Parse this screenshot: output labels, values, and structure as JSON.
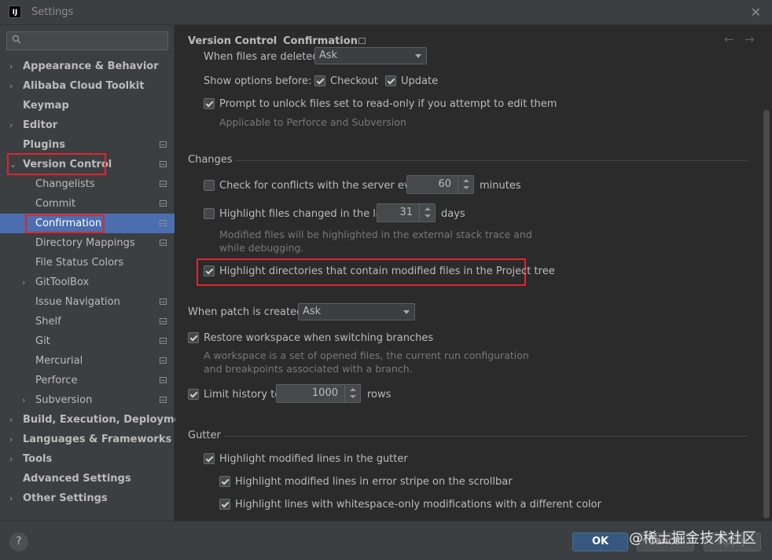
{
  "window": {
    "app_logo": "IJ",
    "title": "Settings",
    "close": "✕"
  },
  "sidebar": {
    "search_placeholder": "",
    "items": [
      {
        "label": "Appearance & Behavior",
        "arrow": "›",
        "bold": true
      },
      {
        "label": "Alibaba Cloud Toolkit",
        "arrow": "›",
        "bold": true
      },
      {
        "label": "Keymap",
        "arrow": "",
        "bold": true
      },
      {
        "label": "Editor",
        "arrow": "›",
        "bold": true
      },
      {
        "label": "Plugins",
        "arrow": "",
        "bold": true,
        "page_icon": true
      },
      {
        "label": "Version Control",
        "arrow": "⌄",
        "bold": true,
        "page_icon": true,
        "highlighted": true
      },
      {
        "label": "Changelists",
        "arrow": "",
        "child": true,
        "page_icon": true
      },
      {
        "label": "Commit",
        "arrow": "",
        "child": true,
        "page_icon": true
      },
      {
        "label": "Confirmation",
        "arrow": "",
        "child": true,
        "page_icon": true,
        "selected": true,
        "highlighted": true
      },
      {
        "label": "Directory Mappings",
        "arrow": "",
        "child": true,
        "page_icon": true
      },
      {
        "label": "File Status Colors",
        "arrow": "",
        "child": true
      },
      {
        "label": "GitToolBox",
        "arrow": "›",
        "child": true
      },
      {
        "label": "Issue Navigation",
        "arrow": "",
        "child": true,
        "page_icon": true
      },
      {
        "label": "Shelf",
        "arrow": "",
        "child": true,
        "page_icon": true
      },
      {
        "label": "Git",
        "arrow": "",
        "child": true,
        "page_icon": true
      },
      {
        "label": "Mercurial",
        "arrow": "",
        "child": true,
        "page_icon": true
      },
      {
        "label": "Perforce",
        "arrow": "",
        "child": true,
        "page_icon": true
      },
      {
        "label": "Subversion",
        "arrow": "›",
        "child": true,
        "page_icon": true
      },
      {
        "label": "Build, Execution, Deployment",
        "arrow": "›",
        "bold": true
      },
      {
        "label": "Languages & Frameworks",
        "arrow": "›",
        "bold": true
      },
      {
        "label": "Tools",
        "arrow": "›",
        "bold": true
      },
      {
        "label": "Advanced Settings",
        "arrow": "",
        "bold": true
      },
      {
        "label": "Other Settings",
        "arrow": "›",
        "bold": true
      }
    ]
  },
  "breadcrumb": {
    "parent": "Version Control",
    "separator": "›",
    "current": "Confirmation",
    "back": "←",
    "forward": "→"
  },
  "content": {
    "files_deleted_label": "When files are deleted:",
    "files_deleted_value": "Ask",
    "show_options_label": "Show options before:",
    "checkout_label": "Checkout",
    "checkout_checked": true,
    "update_label": "Update",
    "update_checked": true,
    "unlock_label": "Prompt to unlock files set to read-only if you attempt to edit them",
    "unlock_checked": true,
    "unlock_hint": "Applicable to Perforce and Subversion",
    "changes_section": "Changes",
    "conflicts_label": "Check for conflicts with the server every",
    "conflicts_checked": false,
    "conflicts_value": "60",
    "conflicts_unit": "minutes",
    "highlight_changed_label": "Highlight files changed in the last",
    "highlight_changed_checked": false,
    "highlight_changed_value": "31",
    "highlight_changed_unit": "days",
    "highlight_hint_1": "Modified files will be highlighted in the external stack trace and",
    "highlight_hint_2": "while debugging.",
    "highlight_dirs_label": "Highlight directories that contain modified files in the Project tree",
    "highlight_dirs_checked": true,
    "patch_label": "When patch is created:",
    "patch_value": "Ask",
    "restore_label": "Restore workspace when switching branches",
    "restore_checked": true,
    "restore_hint_1": "A workspace is a set of opened files, the current run configuration",
    "restore_hint_2": "and breakpoints associated with a branch.",
    "limit_label": "Limit history to",
    "limit_checked": true,
    "limit_value": "1000",
    "limit_unit": "rows",
    "gutter_section": "Gutter",
    "gutter_lines_label": "Highlight modified lines in the gutter",
    "gutter_lines_checked": true,
    "gutter_stripe_label": "Highlight modified lines in error stripe on the scrollbar",
    "gutter_stripe_checked": true,
    "gutter_whitespace_label": "Highlight lines with whitespace-only modifications with a different color",
    "gutter_whitespace_checked": true
  },
  "footer": {
    "help": "?",
    "ok": "OK",
    "cancel": "Cancel",
    "apply": "Apply",
    "watermark": "@稀土掘金技术社区"
  },
  "colors": {
    "highlight_box": "#e0242e",
    "selection": "#4b6eaf",
    "background": "#2b2b2b",
    "panel": "#3c3f41"
  }
}
